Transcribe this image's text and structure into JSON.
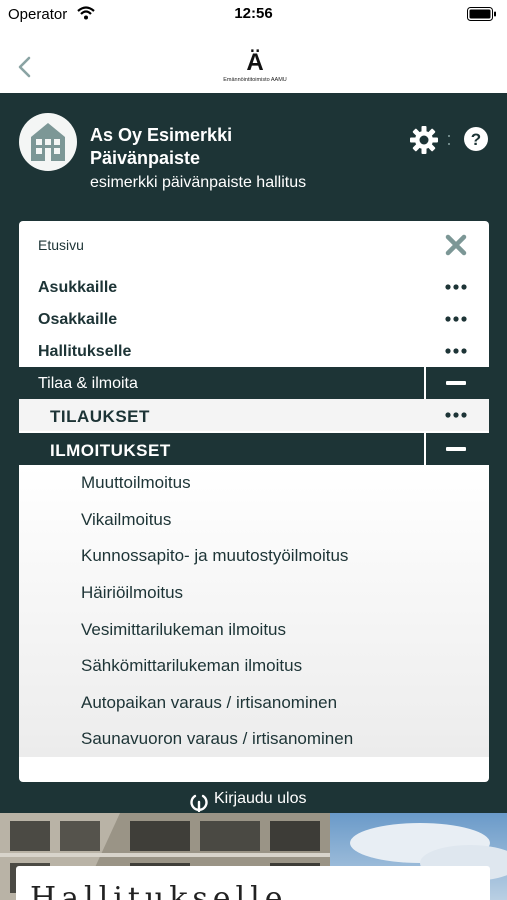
{
  "status_bar": {
    "carrier": "Operator",
    "time": "12:56"
  },
  "nav": {
    "back_icon": "chevron-left-icon",
    "logo_mark": "Ä",
    "logo_text": "Emännöintitoimisto AAMU"
  },
  "header": {
    "title": "As Oy Esimerkki Päivänpaiste",
    "subtitle": "esimerkki päivänpaiste hallitus",
    "avatar_icon": "house-icon",
    "settings_icon": "gear-icon",
    "help_icon": "question-icon"
  },
  "menu": {
    "home_label": "Etusivu",
    "items": [
      {
        "label": "Asukkaille",
        "action": "more"
      },
      {
        "label": "Osakkaille",
        "action": "more"
      },
      {
        "label": "Hallitukselle",
        "action": "more"
      },
      {
        "label": "Tilaa & ilmoita",
        "action": "collapse"
      },
      {
        "label": "TILAUKSET",
        "action": "more"
      },
      {
        "label": "ILMOITUKSET",
        "action": "collapse"
      }
    ],
    "sub_items": [
      "Muuttoilmoitus",
      "Vikailmoitus",
      "Kunnossapito- ja muutostyöilmoitus",
      "Häiriöilmoitus",
      "Vesimittarilukeman ilmoitus",
      "Sähkömittarilukeman ilmoitus",
      "Autopaikan varaus / irtisanominen",
      "Saunavuoron varaus / irtisanominen"
    ]
  },
  "logout": {
    "label": "Kirjaudu ulos",
    "icon": "power-icon"
  },
  "card": {
    "title": "Hallitukselle"
  },
  "colors": {
    "primary": "#1d3436",
    "panel": "#ffffff",
    "accent_text": "#ffffff"
  }
}
